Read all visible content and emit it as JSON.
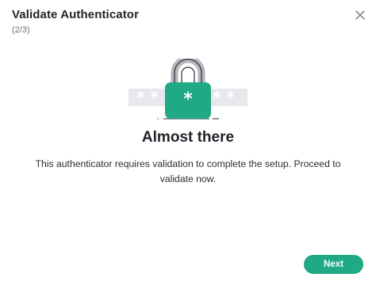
{
  "dialog": {
    "title": "Validate Authenticator",
    "step": "(2/3)",
    "close_icon": "close-icon"
  },
  "illustration": {
    "icon": "padlock-password-icon",
    "accent_color": "#1fa985"
  },
  "content": {
    "heading": "Almost there",
    "description": "This authenticator requires validation to complete the setup. Proceed to validate now."
  },
  "footer": {
    "next_label": "Next"
  },
  "colors": {
    "primary": "#1fa985",
    "text": "#22252b",
    "muted": "#6b6e74"
  }
}
